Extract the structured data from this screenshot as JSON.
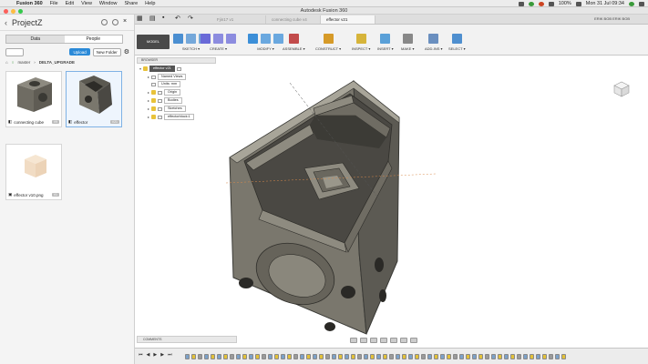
{
  "menubar": {
    "app_name": "Fusion 360",
    "items": [
      "File",
      "Edit",
      "View",
      "Window",
      "Share",
      "Help"
    ],
    "battery": "100%",
    "clock": "Mon 31 Jul  09:34"
  },
  "window": {
    "title": "Autodesk Fusion 360"
  },
  "data_panel": {
    "project": "ProjectZ",
    "tabs": [
      "Data",
      "People"
    ],
    "upload_label": "Upload",
    "new_folder_label": "New Folder",
    "breadcrumb": [
      "master",
      "DELTA_UPGRADE"
    ],
    "files": [
      {
        "name": "connecting cube",
        "version": "V9"
      },
      {
        "name": "effector",
        "version": "V21"
      },
      {
        "name": "effector v10.png",
        "version": "V1"
      }
    ]
  },
  "document_tabs": [
    {
      "label": "Fjin17 v1",
      "active": false
    },
    {
      "label": "connecting cube v4",
      "active": false
    },
    {
      "label": "effector v21",
      "active": true
    }
  ],
  "user_label": "ERIK BOB ERIK BOB",
  "toolbar": {
    "workspace": "MODEL",
    "groups": [
      {
        "label": "SKETCH",
        "color": "#4b8fd1"
      },
      {
        "label": "CREATE",
        "color": "#6a6ad8"
      },
      {
        "label": "MODIFY",
        "color": "#3c8fd8"
      },
      {
        "label": "ASSEMBLE",
        "color": "#c24b4b"
      },
      {
        "label": "CONSTRUCT",
        "color": "#d69a28"
      },
      {
        "label": "INSPECT",
        "color": "#d6b43a"
      },
      {
        "label": "INSERT",
        "color": "#5aa0d8"
      },
      {
        "label": "MAKE",
        "color": "#888888"
      },
      {
        "label": "ADD-INS",
        "color": "#6a8fbf"
      },
      {
        "label": "SELECT",
        "color": "#4f8fcf"
      }
    ]
  },
  "browser": {
    "title": "BROWSER",
    "root": "effector v21",
    "nodes": [
      "Named Views",
      "Units: mm",
      "Origin",
      "Bodies",
      "Sketches",
      "effectorblock:1"
    ]
  },
  "comments_label": "COMMENTS",
  "colors": {
    "accent": "#2b8ad8",
    "model_body": "#8a877c",
    "model_edge": "#3a3a36"
  }
}
